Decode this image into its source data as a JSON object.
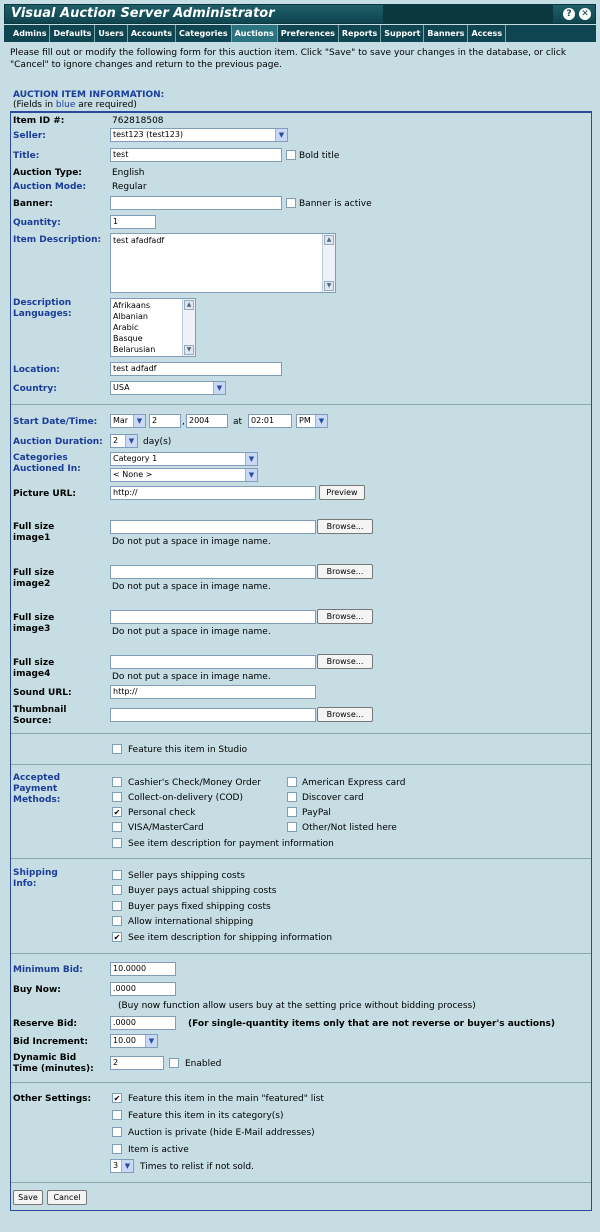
{
  "app_title": "Visual Auction Server Administrator",
  "title_icons": {
    "help": "?",
    "close": "✕"
  },
  "tabs": [
    "Admins",
    "Defaults",
    "Users",
    "Accounts",
    "Categories",
    "Auctions",
    "Preferences",
    "Reports",
    "Support",
    "Banners",
    "Access"
  ],
  "active_tab": "Auctions",
  "intro": "Please fill out or modify the following form for this auction item. Click \"Save\" to save your changes in the database, or click \"Cancel\" to ignore changes and return to the previous page.",
  "section_title": "AUCTION ITEM INFORMATION:",
  "required_note": {
    "pre": "(Fields in ",
    "blue": "blue",
    "post": " are required)"
  },
  "fields": {
    "item_id_label": "Item ID #:",
    "item_id": "762818508",
    "seller_label": "Seller:",
    "seller": "test123 (test123)",
    "title_label": "Title:",
    "title": "test",
    "bold_title": "Bold title",
    "auction_type_label": "Auction Type:",
    "auction_type": "English",
    "auction_mode_label": "Auction Mode:",
    "auction_mode": "Regular",
    "banner_label": "Banner:",
    "banner": "",
    "banner_active": "Banner is active",
    "quantity_label": "Quantity:",
    "quantity": "1",
    "description_label": "Item Description:",
    "description": "test afadfadf",
    "languages_label": "Description Languages:",
    "languages": [
      "Afrikaans",
      "Albanian",
      "Arabic",
      "Basque",
      "Belarusian"
    ],
    "location_label": "Location:",
    "location": "test adfadf",
    "country_label": "Country:",
    "country": "USA",
    "start_label": "Start Date/Time:",
    "start_month": "Mar",
    "start_day": "2",
    "start_comma": ",",
    "start_year": "2004",
    "at": "at",
    "start_time": "02:01",
    "start_ampm": "PM",
    "duration_label": "Auction Duration:",
    "duration": "2",
    "duration_unit": "day(s)",
    "categories_label": "Categories Auctioned In:",
    "category1": "Category 1",
    "category2": "< None >",
    "picture_label": "Picture URL:",
    "picture_url": "http://",
    "preview": "Preview",
    "image1_label": "Full size image1",
    "image2_label": "Full size image2",
    "image3_label": "Full size image3",
    "image4_label": "Full size image4",
    "browse": "Browse...",
    "no_space": "Do not put a space in image name.",
    "sound_label": "Sound URL:",
    "sound_url": "http://",
    "thumb_label": "Thumbnail Source:",
    "feature_studio": "Feature this item in Studio",
    "payment_label": "Accepted Payment Methods:",
    "payments": [
      {
        "label": "Cashier's Check/Money Order",
        "checked": false
      },
      {
        "label": "Collect-on-delivery (COD)",
        "checked": false
      },
      {
        "label": "Personal check",
        "checked": true
      },
      {
        "label": "VISA/MasterCard",
        "checked": false
      },
      {
        "label": "American Express card",
        "checked": false
      },
      {
        "label": "Discover card",
        "checked": false
      },
      {
        "label": "PayPal",
        "checked": false
      },
      {
        "label": "Other/Not listed here",
        "checked": false
      }
    ],
    "payment_see": "See item description for payment information",
    "shipping_label": "Shipping Info:",
    "shipping": [
      {
        "label": "Seller pays shipping costs",
        "checked": false
      },
      {
        "label": "Buyer pays actual shipping costs",
        "checked": false
      },
      {
        "label": "Buyer pays fixed shipping costs",
        "checked": false
      },
      {
        "label": "Allow international shipping",
        "checked": false
      },
      {
        "label": "See item description for shipping information",
        "checked": true
      }
    ],
    "min_bid_label": "Minimum Bid:",
    "min_bid": "10.0000",
    "buy_now_label": "Buy Now:",
    "buy_now": ".0000",
    "buy_now_note": "(Buy now function allow users buy at the setting price without bidding process)",
    "reserve_label": "Reserve Bid:",
    "reserve": ".0000",
    "reserve_note": "(For single-quantity items only that are not reverse or buyer's auctions)",
    "increment_label": "Bid Increment:",
    "increment": "10.00",
    "dyn_label": "Dynamic Bid Time (minutes):",
    "dyn_value": "2",
    "dyn_enabled": "Enabled",
    "other_label": "Other Settings:",
    "other": [
      {
        "label": "Feature this item in the main \"featured\" list",
        "checked": true
      },
      {
        "label": "Feature this item in its category(s)",
        "checked": false
      },
      {
        "label": "Auction is private (hide E-Mail addresses)",
        "checked": false
      },
      {
        "label": "Item is active",
        "checked": false
      }
    ],
    "relist": "3",
    "relist_text": "Times to relist if not sold."
  },
  "buttons": {
    "save": "Save",
    "cancel": "Cancel"
  }
}
